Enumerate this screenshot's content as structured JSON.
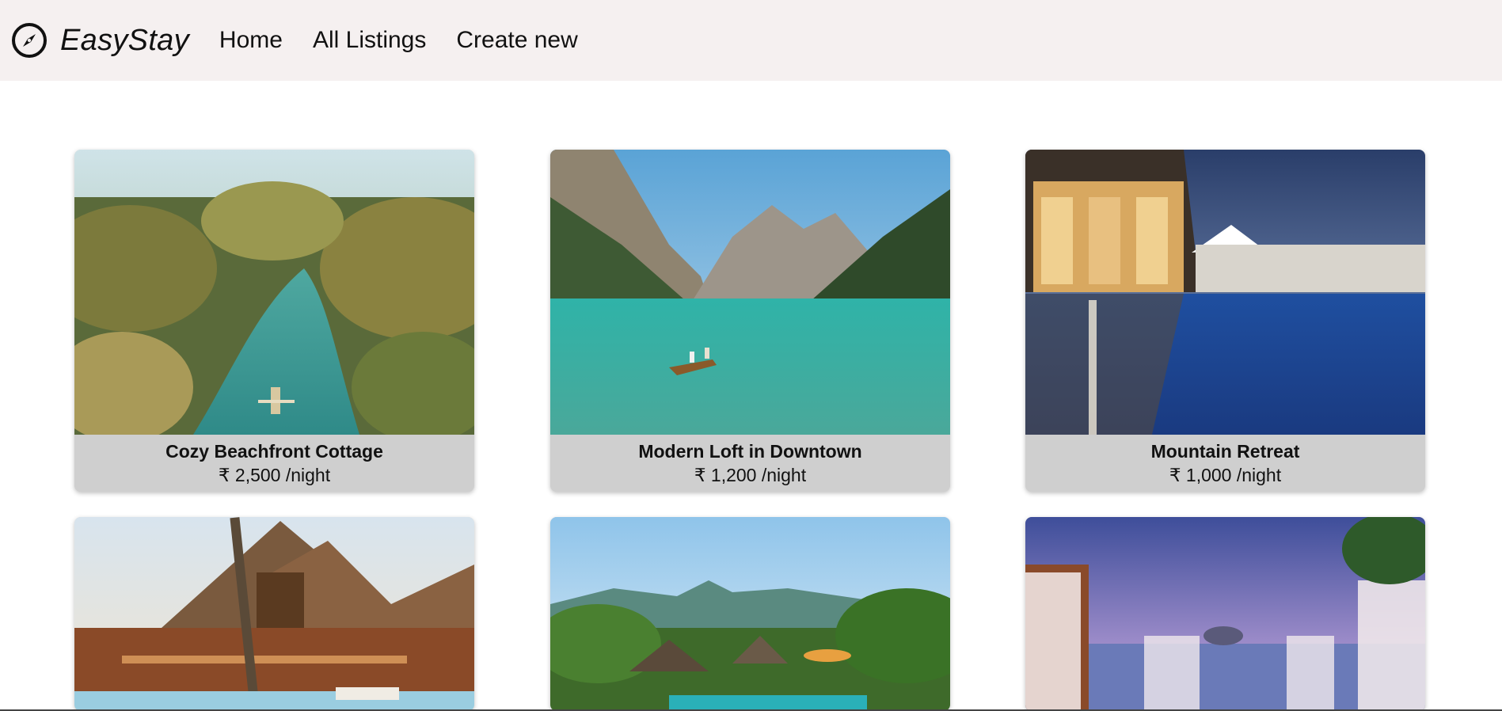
{
  "brand": {
    "name": "EasyStay",
    "icon": "compass-icon"
  },
  "nav": {
    "home": "Home",
    "all_listings": "All Listings",
    "create_new": "Create new"
  },
  "listings": [
    {
      "title": "Cozy Beachfront Cottage",
      "price": "₹ 2,500 /night"
    },
    {
      "title": "Modern Loft in Downtown",
      "price": "₹ 1,200 /night"
    },
    {
      "title": "Mountain Retreat",
      "price": "₹ 1,000 /night"
    },
    {
      "title": "",
      "price": ""
    },
    {
      "title": "",
      "price": ""
    },
    {
      "title": "",
      "price": ""
    }
  ],
  "colors": {
    "navbar_bg": "#f5f0f0",
    "card_footer": "#cfcfcf"
  }
}
